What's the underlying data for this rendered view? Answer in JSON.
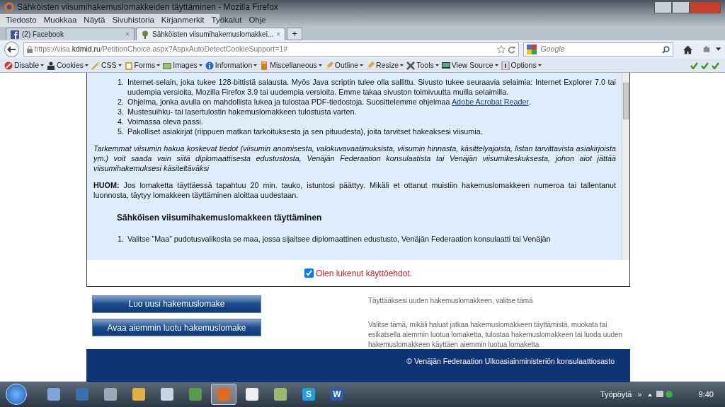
{
  "window": {
    "title": "Sähköisten viisumihakemuslomakkeiden täyttäminen - Mozilla Firefox"
  },
  "menu": [
    "Tiedosto",
    "Muokkaa",
    "Näytä",
    "Sivuhistoria",
    "Kirjanmerkit",
    "Työkalut",
    "Ohje"
  ],
  "tabs": [
    {
      "label": "(2) Facebook",
      "close": "×",
      "selected": false
    },
    {
      "label": "Sähköisten viisumihakemuslomakkei...",
      "close": "×",
      "selected": true
    }
  ],
  "new_tab": "+",
  "address": {
    "prefix": "https://visa.",
    "host": "kdmid.ru",
    "path": "/PetitionChoice.aspx?AspxAutoDetectCookieSupport=1#"
  },
  "search": {
    "placeholder": "Google"
  },
  "devbar": [
    "Disable",
    "Cookies",
    "CSS",
    "Forms",
    "Images",
    "Information",
    "Miscellaneous",
    "Outline",
    "Resize",
    "Tools",
    "View Source",
    "Options"
  ],
  "content": [
    {
      "kind": "list",
      "items": [
        {
          "number": "1.",
          "text": "Internet-selain, joka tukee 128-bittistä salausta. Myös Java scriptin tulee olla sallittu. Sivusto tukee seuraavia selaimia: Internet Explorer 7.0 tai uudempia versioita, Mozilla Firefox 3.9 tai uudempia versioita. Emme takaa sivuston toimivuutta muilla selaimilla."
        },
        {
          "number": "2.",
          "text": "Ohjelma, jonka avulla on mahdollista lukea ja tulostaa PDF-tiedostoja. Suosittelemme ohjelmaa ",
          "link": "Adobe Acrobat Reader",
          "after": "."
        },
        {
          "number": "3.",
          "text": "Mustesuihku- tai lasertulostin hakemuslomakkeen tulostusta varten."
        },
        {
          "number": "4.",
          "text": "Voimassa oleva passi."
        },
        {
          "number": "5.",
          "text": "Pakolliset asiakirjat (riippuen matkan tarkoituksesta ja sen pituudesta), joita tarvitset hakeaksesi viisumia."
        }
      ]
    },
    {
      "kind": "italic",
      "text": "Tarkemmat viisumin hakua koskevat tiedot (viisumin anomisesta, valokuvavaatimuksista, viisumin hinnasta, käsittelyajoista, listan tarvittavista asiakirjoista ym.) voit saada vain siitä diplomaattisesta edustustosta, Venäjän Federaation konsulaatista tai Venäjän viisumikeskuksesta, johon aiot jättää viisumihakemuksesi käsiteltäväksi"
    },
    {
      "kind": "note",
      "text": "**HUOM:** Jos lomaketta täyttäessä tapahtuu 20 min. tauko, istuntosi päättyy. Mikäli et ottanut muistiin hakemuslomakkeen numeroa tai tallentanut luonnosta, täytyy lomakkeen täyttäminen aloittaa uudestaan."
    },
    {
      "kind": "heading",
      "text": "Sähköisen viisumihakemuslomakkeen täyttäminen"
    },
    {
      "kind": "list",
      "items": [
        {
          "number": "1.",
          "text": "Valitse ”Maa” pudotusvalikosta se maa, jossa sijaitsee diplomaattinen edustusto, Venäjän Federaation konsulaatti tai Venäjän"
        }
      ]
    }
  ],
  "agree": {
    "label": "Olen lukenut käyttöehdot.",
    "checked": true
  },
  "actions": [
    {
      "button": "Luo uusi hakemuslomake",
      "description": "Täyttääksesi uuden hakemuslomakkeen, valitse tämä"
    },
    {
      "button": "Avaa aiemmin luotu hakemuslomake",
      "description": "Valitse tämä, mikäli haluat jatkaa hakemuslomakkeen täyttämistä, muokata tai esikatsella aiemmin luotua lomaketta, tulostaa hakemuslomakkeen tai luoda uuden hakemuslomakkeen käyttäen aiemmin luotua lomaketta"
    }
  ],
  "footer": "© Venäjän Federaation Ulkoasiainministeriön konsulaattiosasto",
  "taskbar": {
    "apps": [
      {
        "kind": "plain",
        "color": "#7aa7d8"
      },
      {
        "kind": "plain",
        "color": "#3b6fb0"
      },
      {
        "kind": "plain",
        "color": "#9aa8b8"
      },
      {
        "kind": "plain",
        "color": "#e0b040"
      },
      {
        "kind": "plain",
        "color": "#c8d4e4"
      },
      {
        "kind": "plain",
        "color": "#5a9a50"
      },
      {
        "kind": "plain",
        "color": "#e06a20",
        "active": true
      },
      {
        "kind": "plain",
        "color": "#f0f0f0"
      },
      {
        "kind": "plain",
        "color": "#9ab870"
      },
      {
        "kind": "letter",
        "color": "#1fa0e0",
        "letter": "S"
      },
      {
        "kind": "letter",
        "color": "#2a5cb0",
        "letter": "W"
      }
    ],
    "desktop": "Työpöytä",
    "chevron": "»",
    "time": "9:40"
  }
}
